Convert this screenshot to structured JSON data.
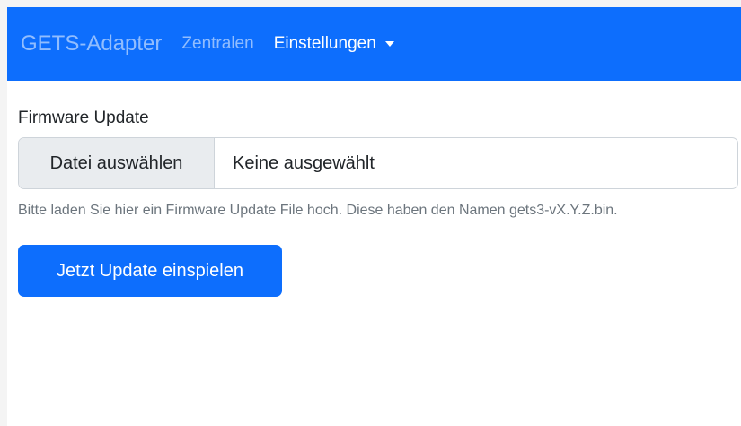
{
  "navbar": {
    "brand": "GETS-Adapter",
    "links": [
      {
        "label": "Zentralen"
      },
      {
        "label": "Einstellungen"
      }
    ],
    "colors": {
      "background": "#0d6efd"
    }
  },
  "form": {
    "label": "Firmware Update",
    "file_button": "Datei auswählen",
    "file_status": "Keine ausgewählt",
    "help": "Bitte laden Sie hier ein Firmware Update File hoch. Diese haben den Namen gets3-vX.Y.Z.bin.",
    "submit": "Jetzt Update einspielen"
  }
}
